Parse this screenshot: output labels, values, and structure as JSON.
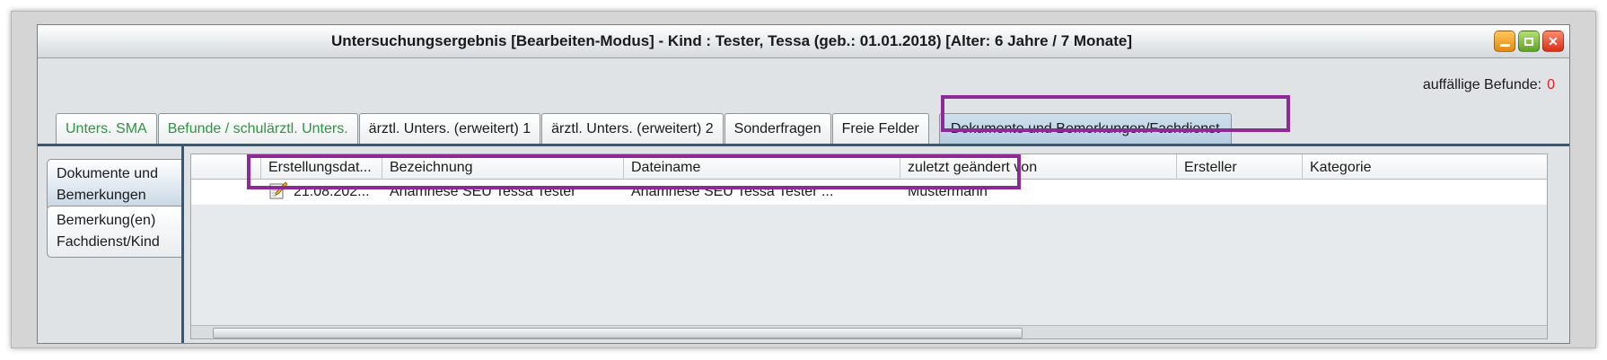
{
  "window": {
    "title": "Untersuchungsergebnis [Bearbeiten-Modus] - Kind : Tester, Tessa  (geb.: 01.01.2018) [Alter: 6 Jahre / 7 Monate]",
    "buttons": {
      "minimize_icon": "minimize-icon",
      "maximize_icon": "maximize-icon",
      "close_icon": "close-icon",
      "close_glyph": "✕"
    }
  },
  "findings": {
    "label": "auffällige Befunde:",
    "count": "0",
    "count_color": "#e02020"
  },
  "tabs": [
    {
      "label": "Unters. SMA",
      "color": "#2f9444"
    },
    {
      "label": "Befunde / schulärztl. Unters.",
      "color": "#2f9444"
    },
    {
      "label": "ärztl. Unters. (erweitert) 1"
    },
    {
      "label": "ärztl. Unters. (erweitert) 2"
    },
    {
      "label": "Sonderfragen"
    },
    {
      "label": "Freie Felder"
    },
    {
      "label": "Dokumente und Bemerkungen/Fachdienst",
      "active": true
    }
  ],
  "side_tabs": [
    {
      "line1": "Dokumente und",
      "line2": "Bemerkungen",
      "active": true
    },
    {
      "line1": "Bemerkung(en)",
      "line2": "Fachdienst/Kind"
    }
  ],
  "table": {
    "columns": [
      "",
      "Erstellungsdat...",
      "Bezeichnung",
      "Dateiname",
      "zuletzt geändert von",
      "Ersteller",
      "Kategorie"
    ],
    "rows": [
      {
        "icon": "edit-document-icon",
        "date": "21.08.202...",
        "bezeichnung": "Anamnese SEU Tessa Tester",
        "dateiname": "Anamnese SEU Tessa Tester ...",
        "geaendert_von": "Mustermann",
        "ersteller": "",
        "kategorie": ""
      }
    ]
  },
  "highlight_color": "#8e2a98"
}
